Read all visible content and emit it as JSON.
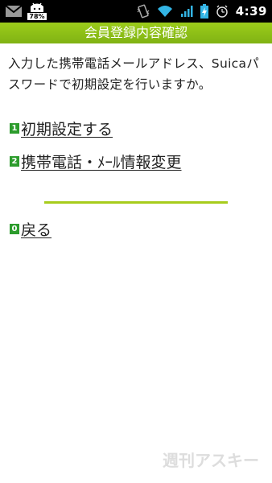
{
  "status_bar": {
    "battery_widget_percent": "78%",
    "time": "4:39",
    "icons": [
      "gmail-icon",
      "battery-widget-icon",
      "vibrate-icon",
      "wifi-icon",
      "signal-icon",
      "battery-charging-icon",
      "alarm-icon"
    ]
  },
  "header": {
    "title": "会員登録内容確認"
  },
  "intro": {
    "text": "入力した携帯電話メールアドレス、Suicaパスワードで初期設定を行いますか。"
  },
  "menu": {
    "items": [
      {
        "number": "1",
        "label": "初期設定する"
      },
      {
        "number": "2",
        "label": "携帯電話・ﾒｰﾙ情報変更"
      }
    ],
    "back": {
      "number": "0",
      "label": "戻る"
    }
  },
  "watermark": "週刊アスキー",
  "colors": {
    "header_bg": "#8fc21a",
    "badge_bg": "#2d9c2d",
    "divider": "#a7cc1c"
  }
}
